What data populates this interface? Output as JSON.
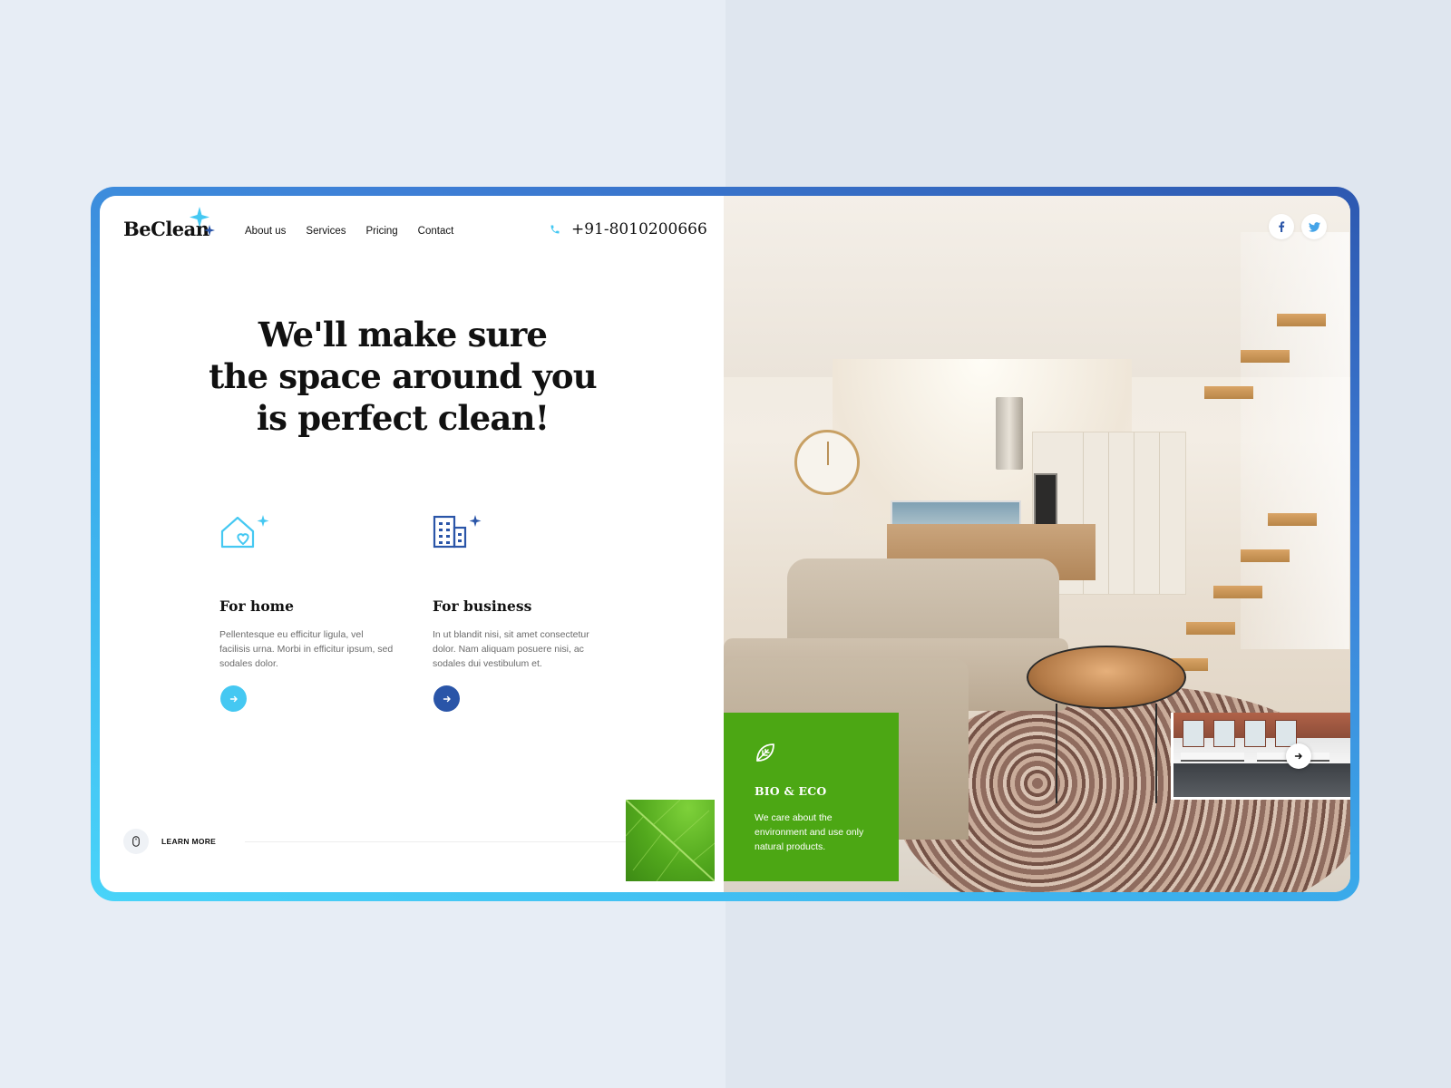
{
  "brand": {
    "name": "BeClean"
  },
  "nav": {
    "items": [
      "About us",
      "Services",
      "Pricing",
      "Contact"
    ]
  },
  "contact": {
    "phone": "+91-8010200666",
    "icon": "phone-icon"
  },
  "hero": {
    "title_line1": "We'll make sure",
    "title_line2": "the space around you",
    "title_line3": "is perfect clean!"
  },
  "cards": [
    {
      "title": "For home",
      "text": "Pellentesque eu efficitur ligula, vel facilisis urna. Morbi in efficitur ipsum, sed sodales dolor.",
      "icon": "house-heart-icon",
      "button_icon": "arrow-right-icon",
      "accent": "#45c8f2"
    },
    {
      "title": "For business",
      "text": "In ut blandit nisi, sit amet consectetur dolor. Nam aliquam posuere nisi, ac sodales dui vestibulum et.",
      "icon": "office-building-icon",
      "button_icon": "arrow-right-icon",
      "accent": "#2a55a8"
    }
  ],
  "learn_more": {
    "label": "LEARN MORE",
    "icon": "mouse-icon"
  },
  "social": [
    "facebook-icon",
    "twitter-icon"
  ],
  "eco": {
    "title": "BIO & ECO",
    "text": "We care about the environment and use only natural products.",
    "icon": "leaf-icon",
    "color": "#4ca714"
  },
  "colors": {
    "primary_dark": "#2a55a8",
    "primary_light": "#45c8f2",
    "eco_green": "#4ca714",
    "text": "#111111",
    "muted": "#6b6b6b"
  }
}
